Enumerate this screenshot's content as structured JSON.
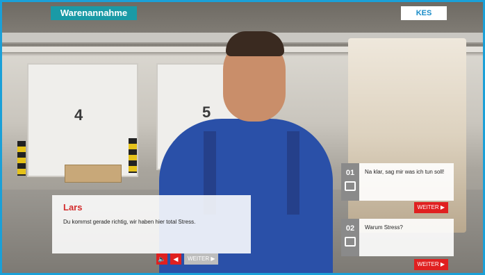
{
  "header": {
    "title": "Warenannahme",
    "logo": "KES"
  },
  "background": {
    "door1_label": "4",
    "door2_label": "5"
  },
  "speech": {
    "speaker": "Lars",
    "text": "Du kommst gerade richtig, wir haben hier total Stress.",
    "controls": {
      "audio_icon": "speaker-icon",
      "back_icon": "back-arrow-icon",
      "weiter_label": "WEITER ▶"
    }
  },
  "options": [
    {
      "number": "01",
      "text": "Na klar, sag mir was ich tun soll!",
      "button": "WEITER ▶",
      "icon": "speech-bubble-icon"
    },
    {
      "number": "02",
      "text": "Warum Stress?",
      "button": "WEITER ▶",
      "icon": "speech-bubble-icon"
    }
  ],
  "colors": {
    "accent": "#1a9aa6",
    "red": "#e02020",
    "border": "#1aa0d8"
  }
}
